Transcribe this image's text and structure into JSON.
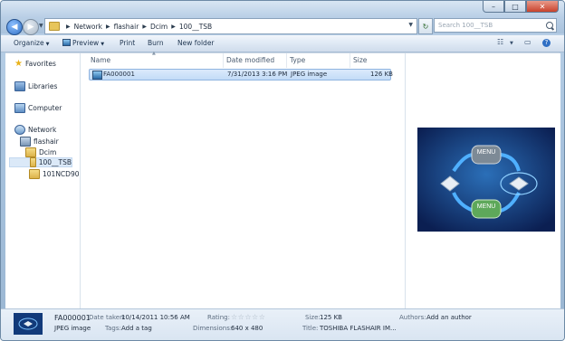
{
  "address": {
    "path": [
      "Network",
      "flashair",
      "Dcim",
      "100__TSB"
    ]
  },
  "search": {
    "placeholder": "Search 100__TSB"
  },
  "window_buttons": {
    "min": "–",
    "max": "□",
    "close": "✕"
  },
  "toolbar": {
    "organize": "Organize",
    "preview": "Preview",
    "print": "Print",
    "burn": "Burn",
    "new_folder": "New folder"
  },
  "nav": {
    "favorites": "Favorites",
    "libraries": "Libraries",
    "computer": "Computer",
    "network": "Network",
    "flashair": "flashair",
    "dcim": "Dcim",
    "tsb": "100__TSB",
    "ncd": "101NCD90"
  },
  "columns": {
    "name": "Name",
    "date": "Date modified",
    "type": "Type",
    "size": "Size"
  },
  "file": {
    "name": "FA000001",
    "date": "7/31/2013 3:16 PM",
    "type": "JPEG image",
    "size": "126 KB"
  },
  "preview_image": {
    "menu_top": "MENU",
    "menu_bottom": "MENU"
  },
  "details": {
    "name": "FA000001",
    "type": "JPEG image",
    "date_taken_label": "Date taken:",
    "date_taken": "10/14/2011 10:56 AM",
    "tags_label": "Tags:",
    "tags": "Add a tag",
    "rating_label": "Rating:",
    "rating": "☆☆☆☆☆",
    "dimensions_label": "Dimensions:",
    "dimensions": "640 x 480",
    "size_label": "Size:",
    "size": "125 KB",
    "title_label": "Title:",
    "title": "TOSHIBA FLASHAIR IM...",
    "authors_label": "Authors:",
    "authors": "Add an author"
  }
}
